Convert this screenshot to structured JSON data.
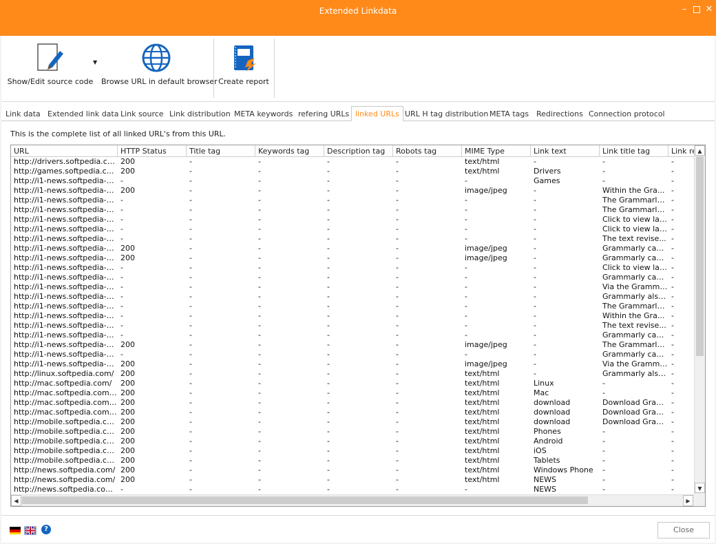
{
  "window": {
    "title": "Extended Linkdata"
  },
  "toolbar": {
    "show_edit_label": "Show/Edit source code",
    "browse_label": "Browse URL in default browser",
    "report_label": "Create report"
  },
  "tabs": [
    {
      "label": "Link data"
    },
    {
      "label": "Extended link data"
    },
    {
      "label": "Link source"
    },
    {
      "label": "Link distribution"
    },
    {
      "label": "META keywords"
    },
    {
      "label": "refering URLs"
    },
    {
      "label": "linked URLs",
      "active": true
    },
    {
      "label": "URL H tag distribution"
    },
    {
      "label": "META tags"
    },
    {
      "label": "Redirections"
    },
    {
      "label": "Connection protocol"
    }
  ],
  "panel": {
    "description": "This is the complete list of all linked URL's from this URL."
  },
  "table": {
    "columns": [
      "URL",
      "HTTP Status",
      "Title tag",
      "Keywords tag",
      "Description tag",
      "Robots tag",
      "MIME Type",
      "Link text",
      "Link title tag",
      "Link re"
    ],
    "rows": [
      [
        "http://drivers.softpedia.com/",
        "200",
        "-",
        "-",
        "-",
        "-",
        "text/html",
        "-",
        "-",
        "-"
      ],
      [
        "http://games.softpedia.com/",
        "200",
        "-",
        "-",
        "-",
        "-",
        "text/html",
        "Drivers",
        "-",
        "-"
      ],
      [
        "http://i1-news.softpedia-sta...",
        "-",
        "-",
        "-",
        "-",
        "-",
        "-",
        "Games",
        "-",
        "-"
      ],
      [
        "http://i1-news.softpedia-sta...",
        "200",
        "-",
        "-",
        "-",
        "-",
        "image/jpeg",
        "-",
        "Within the Gra...",
        "-"
      ],
      [
        "http://i1-news.softpedia-sta...",
        "-",
        "-",
        "-",
        "-",
        "-",
        "-",
        "-",
        "The Grammarly ...",
        "-"
      ],
      [
        "http://i1-news.softpedia-sta...",
        "-",
        "-",
        "-",
        "-",
        "-",
        "-",
        "-",
        "The Grammarly ...",
        "-"
      ],
      [
        "http://i1-news.softpedia-sta...",
        "-",
        "-",
        "-",
        "-",
        "-",
        "-",
        "-",
        "Click to view lar...",
        "-"
      ],
      [
        "http://i1-news.softpedia-sta...",
        "-",
        "-",
        "-",
        "-",
        "-",
        "-",
        "-",
        "Click to view lar...",
        "-"
      ],
      [
        "http://i1-news.softpedia-sta...",
        "-",
        "-",
        "-",
        "-",
        "-",
        "-",
        "-",
        "The text revise...",
        "-"
      ],
      [
        "http://i1-news.softpedia-sta...",
        "200",
        "-",
        "-",
        "-",
        "-",
        "image/jpeg",
        "-",
        "Grammarly can ...",
        "-"
      ],
      [
        "http://i1-news.softpedia-sta...",
        "200",
        "-",
        "-",
        "-",
        "-",
        "image/jpeg",
        "-",
        "Grammarly can ...",
        "-"
      ],
      [
        "http://i1-news.softpedia-sta...",
        "-",
        "-",
        "-",
        "-",
        "-",
        "-",
        "-",
        "Click to view lar...",
        "-"
      ],
      [
        "http://i1-news.softpedia-sta...",
        "-",
        "-",
        "-",
        "-",
        "-",
        "-",
        "-",
        "Grammarly can ...",
        "-"
      ],
      [
        "http://i1-news.softpedia-sta...",
        "-",
        "-",
        "-",
        "-",
        "-",
        "-",
        "-",
        "Via the Gramma...",
        "-"
      ],
      [
        "http://i1-news.softpedia-sta...",
        "-",
        "-",
        "-",
        "-",
        "-",
        "-",
        "-",
        "Grammarly also ...",
        "-"
      ],
      [
        "http://i1-news.softpedia-sta...",
        "-",
        "-",
        "-",
        "-",
        "-",
        "-",
        "-",
        "The Grammarly ...",
        "-"
      ],
      [
        "http://i1-news.softpedia-sta...",
        "-",
        "-",
        "-",
        "-",
        "-",
        "-",
        "-",
        "Within the Gra...",
        "-"
      ],
      [
        "http://i1-news.softpedia-sta...",
        "-",
        "-",
        "-",
        "-",
        "-",
        "-",
        "-",
        "The text revise...",
        "-"
      ],
      [
        "http://i1-news.softpedia-sta...",
        "-",
        "-",
        "-",
        "-",
        "-",
        "-",
        "-",
        "Grammarly can ...",
        "-"
      ],
      [
        "http://i1-news.softpedia-sta...",
        "200",
        "-",
        "-",
        "-",
        "-",
        "image/jpeg",
        "-",
        "The Grammarly ...",
        "-"
      ],
      [
        "http://i1-news.softpedia-sta...",
        "-",
        "-",
        "-",
        "-",
        "-",
        "-",
        "-",
        "Grammarly can ...",
        "-"
      ],
      [
        "http://i1-news.softpedia-sta...",
        "200",
        "-",
        "-",
        "-",
        "-",
        "image/jpeg",
        "-",
        "Via the Gramma...",
        "-"
      ],
      [
        "http://linux.softpedia.com/",
        "200",
        "-",
        "-",
        "-",
        "-",
        "text/html",
        "-",
        "Grammarly also ...",
        "-"
      ],
      [
        "http://mac.softpedia.com/",
        "200",
        "-",
        "-",
        "-",
        "-",
        "text/html",
        "Linux",
        "-",
        "-"
      ],
      [
        "http://mac.softpedia.com/g...",
        "200",
        "-",
        "-",
        "-",
        "-",
        "text/html",
        "Mac",
        "-",
        "-"
      ],
      [
        "http://mac.softpedia.com/g...",
        "200",
        "-",
        "-",
        "-",
        "-",
        "text/html",
        "download",
        "Download Gram...",
        "-"
      ],
      [
        "http://mac.softpedia.com/g...",
        "200",
        "-",
        "-",
        "-",
        "-",
        "text/html",
        "download",
        "Download Gram...",
        "-"
      ],
      [
        "http://mobile.softpedia.com/",
        "200",
        "-",
        "-",
        "-",
        "-",
        "text/html",
        "download",
        "Download Gram...",
        "-"
      ],
      [
        "http://mobile.softpedia.com...",
        "200",
        "-",
        "-",
        "-",
        "-",
        "text/html",
        "Phones",
        "-",
        "-"
      ],
      [
        "http://mobile.softpedia.com...",
        "200",
        "-",
        "-",
        "-",
        "-",
        "text/html",
        "Android",
        "-",
        "-"
      ],
      [
        "http://mobile.softpedia.com...",
        "200",
        "-",
        "-",
        "-",
        "-",
        "text/html",
        "iOS",
        "-",
        "-"
      ],
      [
        "http://mobile.softpedia.com...",
        "200",
        "-",
        "-",
        "-",
        "-",
        "text/html",
        "Tablets",
        "-",
        "-"
      ],
      [
        "http://news.softpedia.com/",
        "200",
        "-",
        "-",
        "-",
        "-",
        "text/html",
        "Windows Phone",
        "-",
        "-"
      ],
      [
        "http://news.softpedia.com/",
        "200",
        "-",
        "-",
        "-",
        "-",
        "text/html",
        "NEWS",
        "-",
        "-"
      ],
      [
        "http://news.softpedia.com/...",
        "-",
        "-",
        "-",
        "-",
        "-",
        "-",
        "NEWS",
        "-",
        "-"
      ]
    ]
  },
  "footer": {
    "close_label": "Close",
    "help_glyph": "?"
  },
  "icons": {
    "minimize": "minimize-icon",
    "maximize": "maximize-icon",
    "close": "close-icon"
  },
  "colors": {
    "accent": "#ff8a1a",
    "icon_blue": "#1565c0"
  }
}
